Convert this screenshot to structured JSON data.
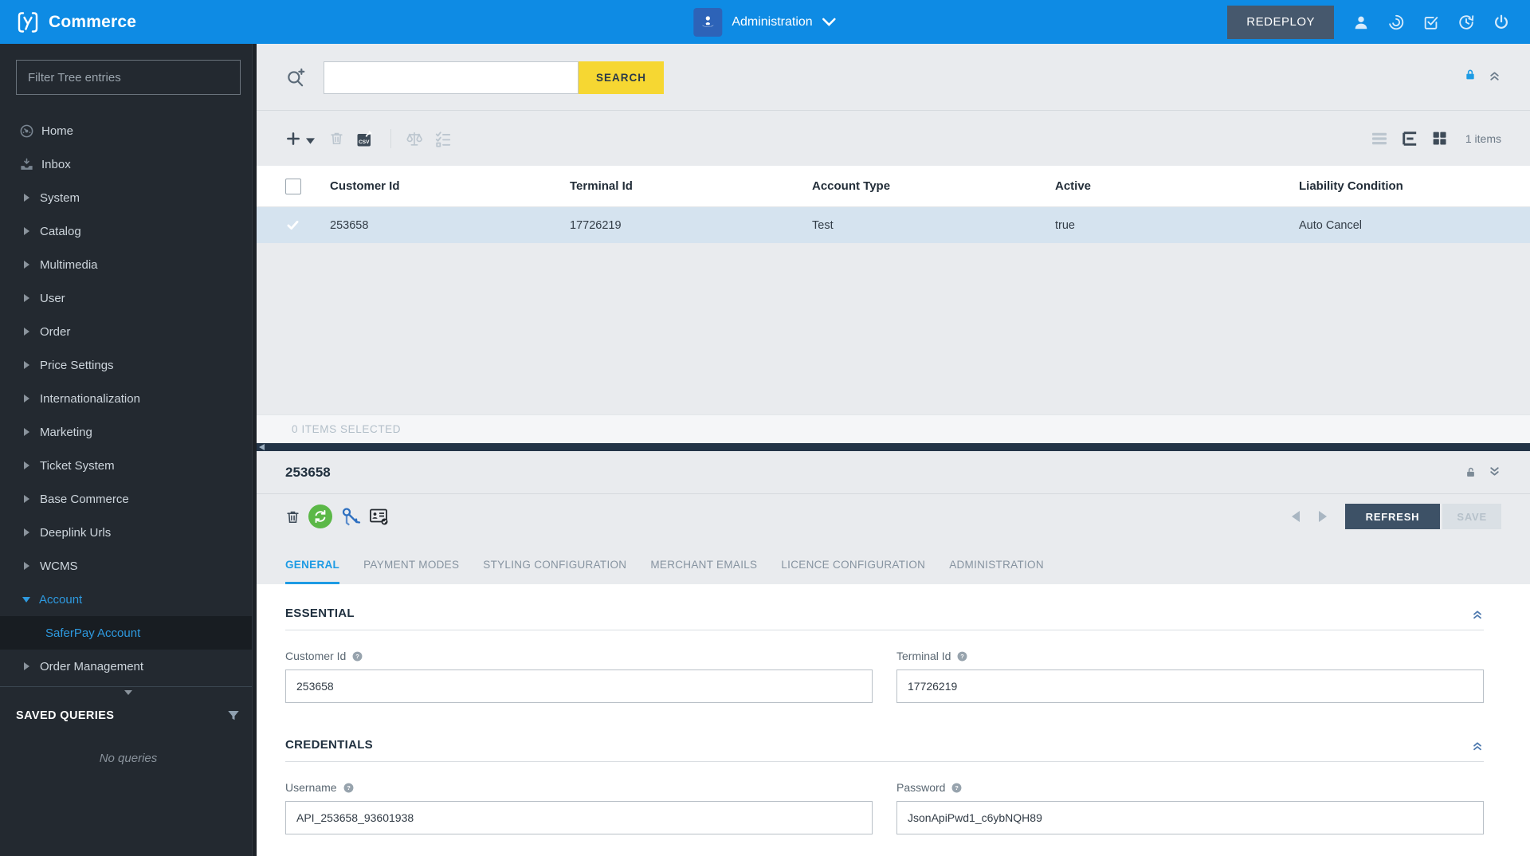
{
  "colors": {
    "header_blue": "#0e8be4",
    "accent_blue": "#1d9be4",
    "search_yellow": "#f6d732",
    "sidebar_bg": "#232930",
    "refresh_button_navy": "#3d5166",
    "selected_row_blue": "#d5e3ef",
    "sync_green": "#5bb847",
    "splitter_dark": "#233447"
  },
  "header": {
    "brand": "Commerce",
    "perspective_label": "Administration",
    "redeploy_label": "REDEPLOY"
  },
  "sidebar": {
    "filter_placeholder": "Filter Tree entries",
    "items": [
      {
        "label": "Home"
      },
      {
        "label": "Inbox"
      },
      {
        "label": "System"
      },
      {
        "label": "Catalog"
      },
      {
        "label": "Multimedia"
      },
      {
        "label": "User"
      },
      {
        "label": "Order"
      },
      {
        "label": "Price Settings"
      },
      {
        "label": "Internationalization"
      },
      {
        "label": "Marketing"
      },
      {
        "label": "Ticket System"
      },
      {
        "label": "Base Commerce"
      },
      {
        "label": "Deeplink Urls"
      },
      {
        "label": "WCMS"
      },
      {
        "label": "Account"
      },
      {
        "label": "SaferPay Account"
      },
      {
        "label": "Order Management"
      }
    ],
    "saved_queries_title": "SAVED QUERIES",
    "no_queries_text": "No queries"
  },
  "grid": {
    "search_button_label": "SEARCH",
    "items_count": "1 items",
    "columns": [
      "Customer Id",
      "Terminal Id",
      "Account Type",
      "Active",
      "Liability Condition"
    ],
    "rows": [
      [
        "253658",
        "17726219",
        "Test",
        "true",
        "Auto Cancel"
      ]
    ],
    "selection_status": "0 ITEMS SELECTED"
  },
  "editor": {
    "title": "253658",
    "refresh_label": "REFRESH",
    "save_label": "SAVE",
    "active_tab": "GENERAL",
    "tabs": [
      "GENERAL",
      "PAYMENT MODES",
      "STYLING CONFIGURATION",
      "MERCHANT EMAILS",
      "LICENCE CONFIGURATION",
      "ADMINISTRATION"
    ],
    "sections": [
      {
        "title": "ESSENTIAL",
        "fields": [
          {
            "label": "Customer Id",
            "value": "253658"
          },
          {
            "label": "Terminal Id",
            "value": "17726219"
          }
        ]
      },
      {
        "title": "CREDENTIALS",
        "fields": [
          {
            "label": "Username",
            "value": "API_253658_93601938"
          },
          {
            "label": "Password",
            "value": "JsonApiPwd1_c6ybNQH89"
          }
        ]
      }
    ]
  }
}
